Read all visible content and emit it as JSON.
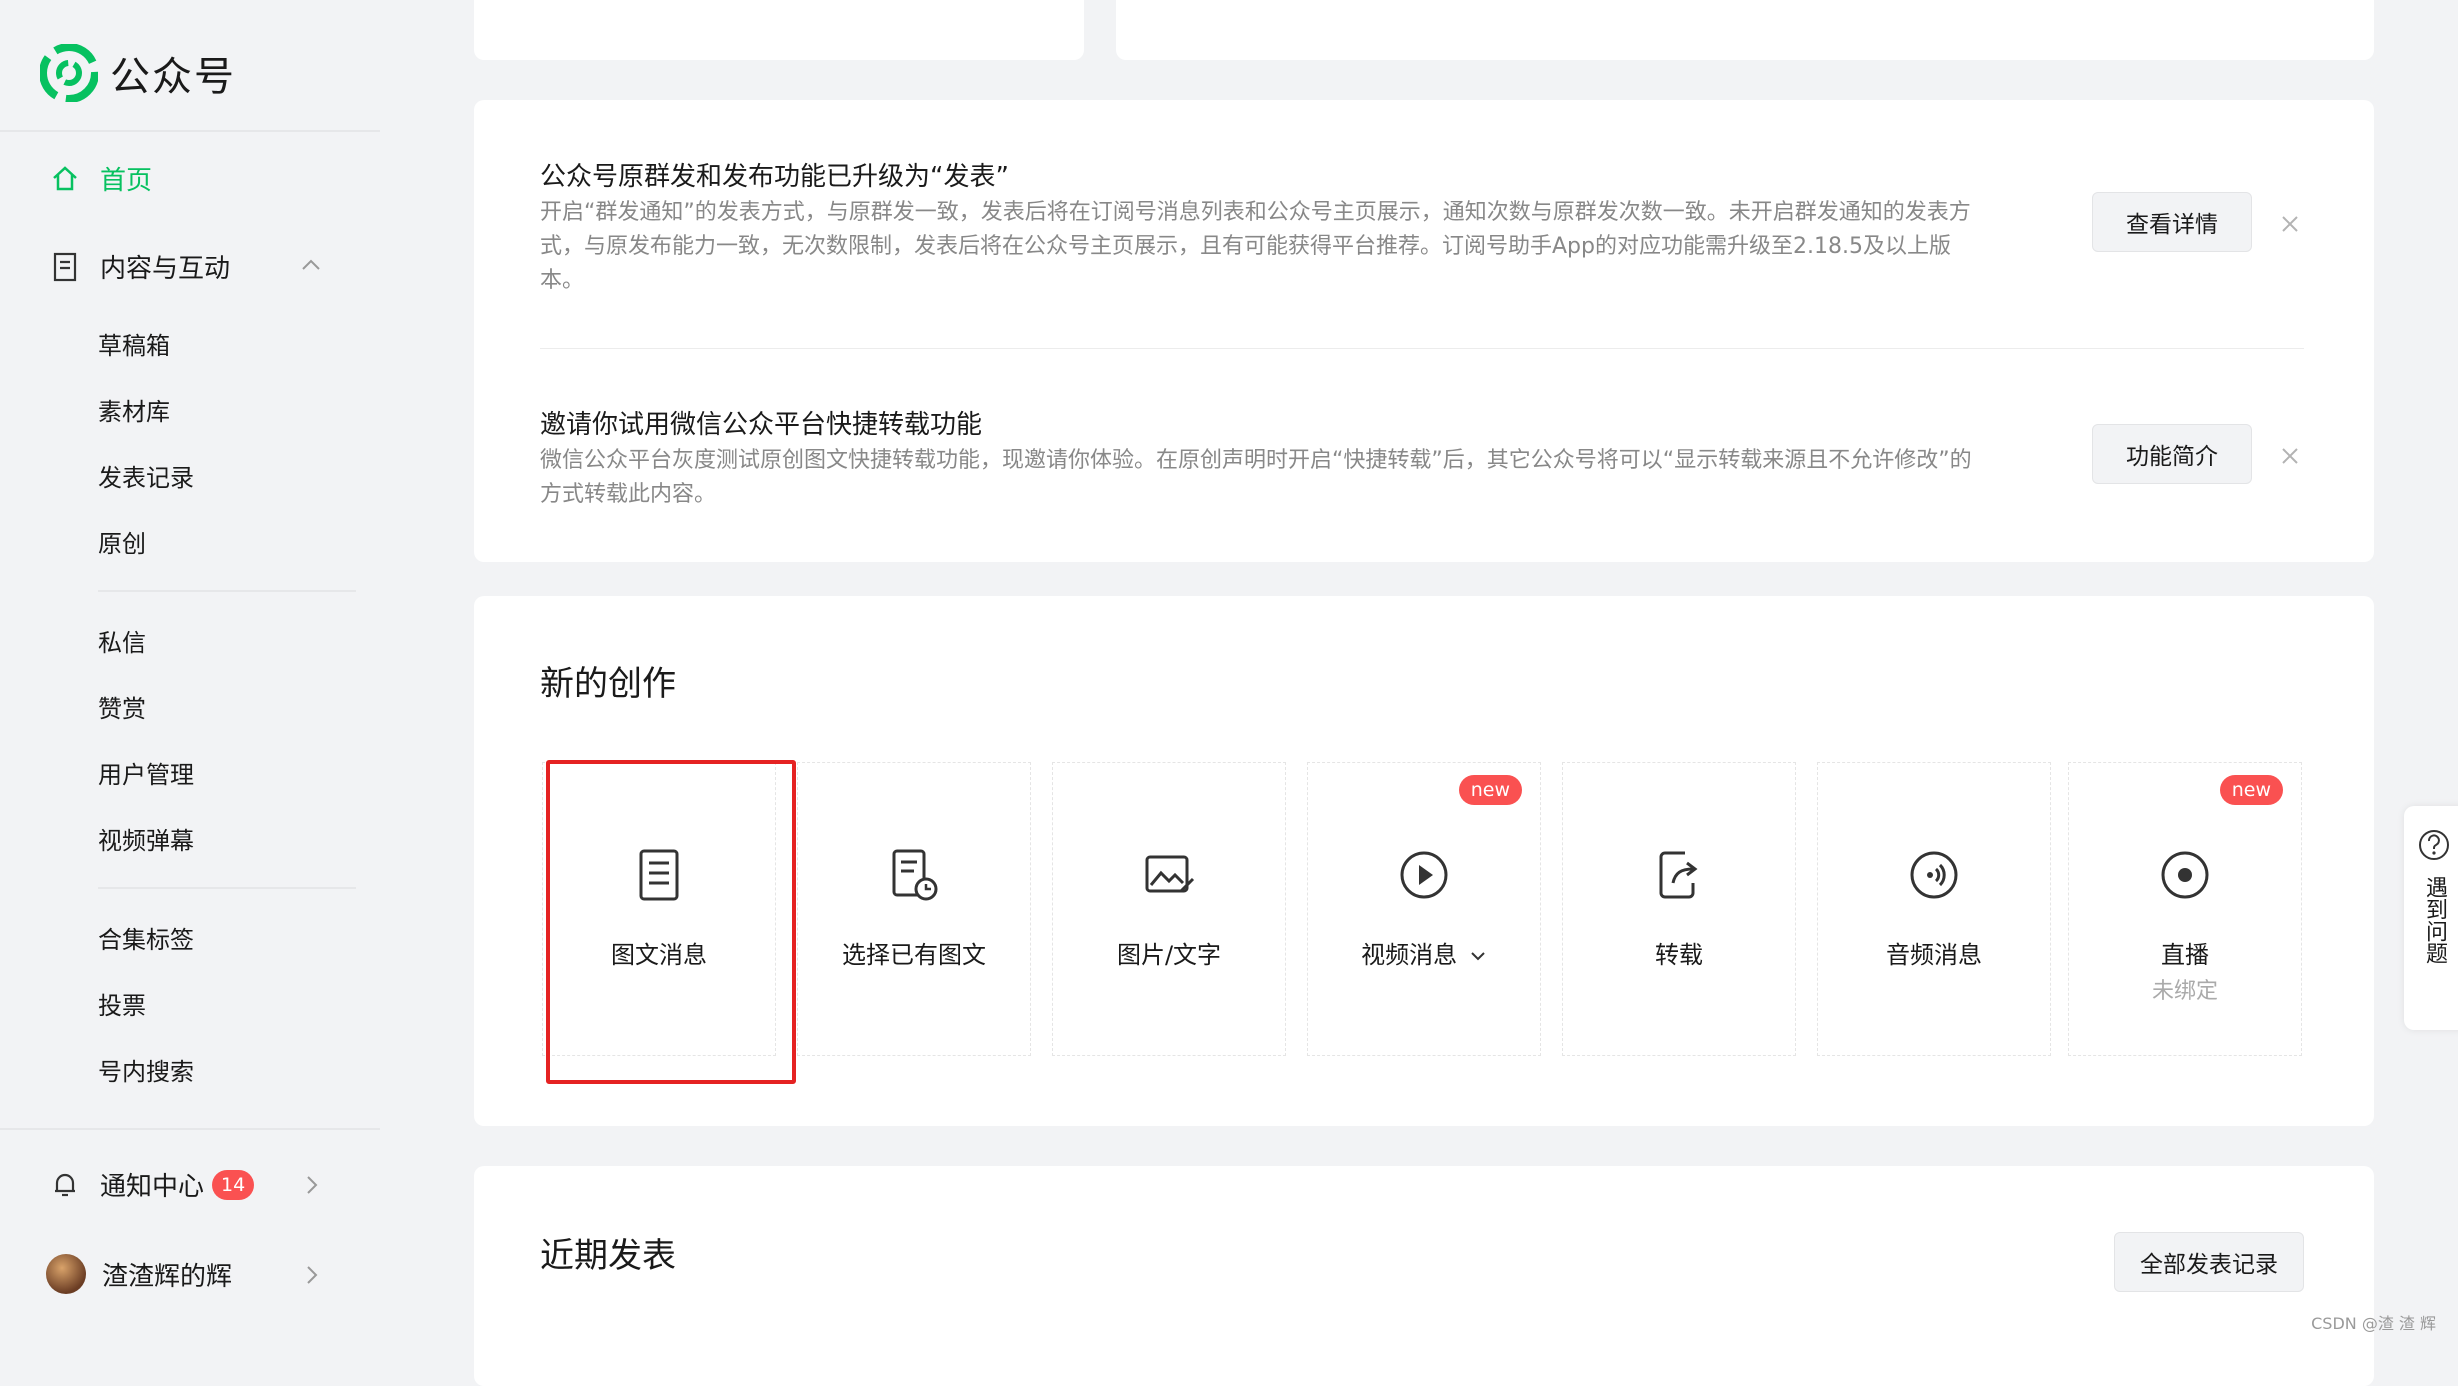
{
  "app": {
    "title": "公众号",
    "brand_color": "#07c160"
  },
  "sidebar": {
    "home_label": "首页",
    "content_section_label": "内容与互动",
    "content_items": [
      "草稿箱",
      "素材库",
      "发表记录",
      "原创"
    ],
    "interaction_items": [
      "私信",
      "赞赏",
      "用户管理",
      "视频弹幕"
    ],
    "tools_items": [
      "合集标签",
      "投票",
      "号内搜索"
    ],
    "notification_label": "通知中心",
    "notification_count": "14",
    "account_name": "渣渣辉的辉"
  },
  "notices": [
    {
      "title": "公众号原群发和发布功能已升级为“发表”",
      "desc": "开启“群发通知”的发表方式，与原群发一致，发表后将在订阅号消息列表和公众号主页展示，通知次数与原群发次数一致。未开启群发通知的发表方式，与原发布能力一致，无次数限制，发表后将在公众号主页展示，且有可能获得平台推荐。订阅号助手App的对应功能需升级至2.18.5及以上版本。",
      "button": "查看详情"
    },
    {
      "title": "邀请你试用微信公众平台快捷转载功能",
      "desc": "微信公众平台灰度测试原创图文快捷转载功能，现邀请你体验。在原创声明时开启“快捷转载”后，其它公众号将可以“显示转载来源且不允许修改”的方式转载此内容。",
      "button": "功能简介"
    }
  ],
  "creation": {
    "title": "新的创作",
    "tiles": [
      {
        "label": "图文消息",
        "icon": "article-icon"
      },
      {
        "label": "选择已有图文",
        "icon": "article-history-icon"
      },
      {
        "label": "图片/文字",
        "icon": "image-icon"
      },
      {
        "label": "视频消息",
        "icon": "play-icon",
        "badge": "new"
      },
      {
        "label": "转载",
        "icon": "share-icon"
      },
      {
        "label": "音频消息",
        "icon": "audio-icon"
      },
      {
        "label": "直播",
        "icon": "live-icon",
        "badge": "new",
        "sub": "未绑定"
      }
    ]
  },
  "recent": {
    "title": "近期发表",
    "all_button": "全部发表记录"
  },
  "help": {
    "label": "遇到问题"
  },
  "watermark": "CSDN @渣 渣 辉"
}
